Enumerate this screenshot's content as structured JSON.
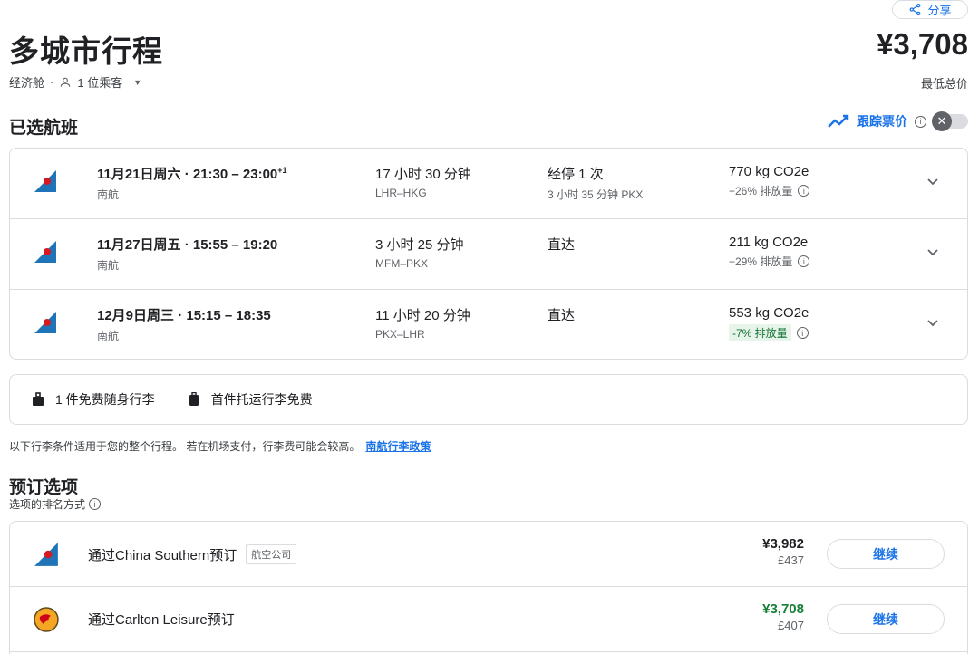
{
  "header": {
    "share_label": "分享",
    "title": "多城市行程",
    "total_price": "¥3,708",
    "price_caption": "最低总价",
    "cabin": "经济舱",
    "separator": "·",
    "passengers": "1 位乘客",
    "icons": [
      "share-icon",
      "person-icon",
      "caret-down-icon"
    ]
  },
  "selected": {
    "title": "已选航班",
    "track_label": "跟踪票价",
    "track_toggle": "off",
    "flights": [
      {
        "date_time": "11月21日周六 · 21:30 – 23:00",
        "day_offset": "+1",
        "airline": "南航",
        "duration": "17 小时 30 分钟",
        "route": "LHR–HKG",
        "stops": "经停 1 次",
        "layover": "3 小时 35 分钟 PKX",
        "co2": "770 kg CO2e",
        "co2_diff": "+26% 排放量"
      },
      {
        "date_time": "11月27日周五 · 15:55 – 19:20",
        "day_offset": "",
        "airline": "南航",
        "duration": "3 小时 25 分钟",
        "route": "MFM–PKX",
        "stops": "直达",
        "layover": "",
        "co2": "211 kg CO2e",
        "co2_diff": "+29% 排放量"
      },
      {
        "date_time": "12月9日周三 · 15:15 – 18:35",
        "day_offset": "",
        "airline": "南航",
        "duration": "11 小时 20 分钟",
        "route": "PKX–LHR",
        "stops": "直达",
        "layover": "",
        "co2": "553 kg CO2e",
        "co2_diff": "-7% 排放量"
      }
    ]
  },
  "baggage": {
    "carry_on": "1 件免费随身行李",
    "checked": "首件托运行李免费",
    "note": "以下行李条件适用于您的整个行程。 若在机场支付，行李费可能会较高。",
    "policy_link": "南航行李政策"
  },
  "booking": {
    "title": "预订选项",
    "sort_label": "选项的排名方式",
    "options": [
      {
        "name": "通过China Southern预订",
        "tag": "航空公司",
        "price_cny": "¥3,982",
        "price_gbp": "£437",
        "button": "继续"
      },
      {
        "name": "通过Carlton Leisure预订",
        "tag": "",
        "price_cny": "¥3,708",
        "price_gbp": "£407",
        "button": "继续"
      }
    ]
  },
  "colors": {
    "accent": "#1a73e8",
    "green": "#188038",
    "border": "#dadce0",
    "airline_blue": "#1f73b7",
    "airline_red": "#d71920"
  }
}
